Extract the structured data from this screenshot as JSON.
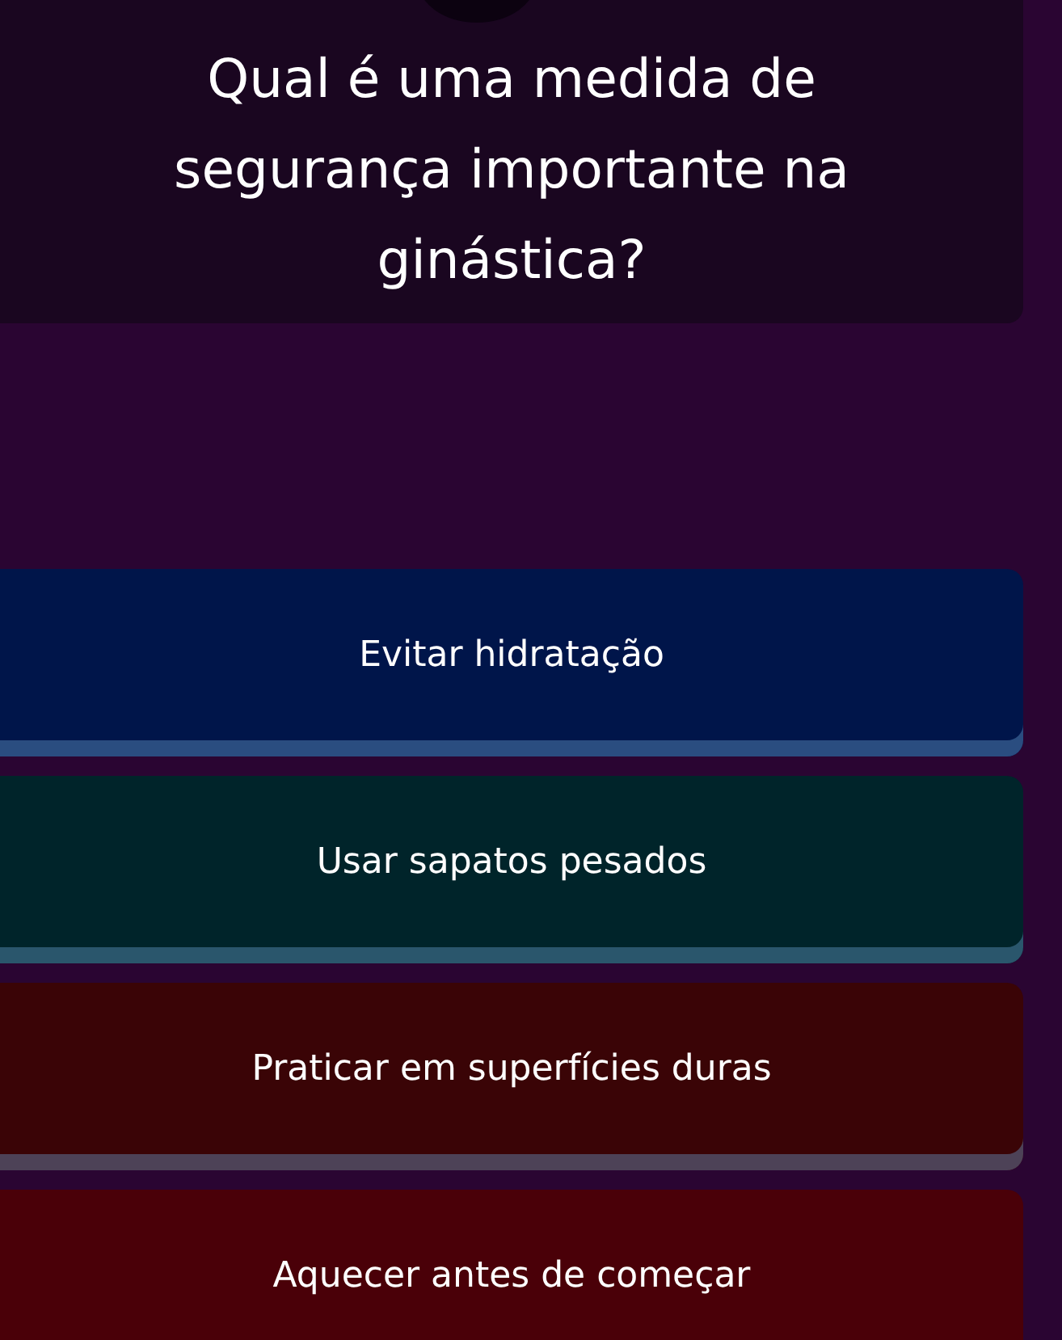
{
  "question": "Qual é uma medida de segurança importante na ginástica?",
  "answers": [
    {
      "label": "Evitar hidratação",
      "color": "#00154a"
    },
    {
      "label": "Usar sapatos pesados",
      "color": "#00242a"
    },
    {
      "label": "Praticar em superfícies duras",
      "color": "#3a0406"
    },
    {
      "label": "Aquecer antes de começar",
      "color": "#4a0008"
    }
  ]
}
